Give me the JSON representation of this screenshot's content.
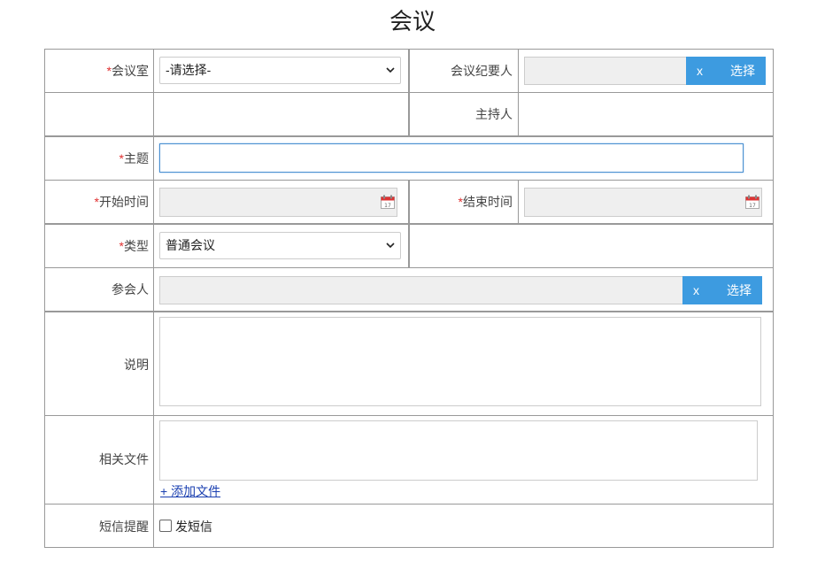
{
  "page": {
    "title": "会议"
  },
  "form": {
    "required_mark": "*",
    "room": {
      "label": "会议室",
      "value": "-请选择-"
    },
    "recorder": {
      "label": "会议纪要人",
      "value": "",
      "clear": "x",
      "choose": "选择"
    },
    "host": {
      "label": "主持人",
      "value": ""
    },
    "subject": {
      "label": "主题",
      "value": ""
    },
    "start_time": {
      "label": "开始时间",
      "value": ""
    },
    "end_time": {
      "label": "结束时间",
      "value": ""
    },
    "type": {
      "label": "类型",
      "value": "普通会议"
    },
    "attendees": {
      "label": "参会人",
      "value": "",
      "clear": "x",
      "choose": "选择"
    },
    "description": {
      "label": "说明",
      "value": ""
    },
    "files": {
      "label": "相关文件",
      "add_link": "+ 添加文件"
    },
    "sms": {
      "label": "短信提醒",
      "checkbox_label": "发短信",
      "checked": false
    }
  },
  "colors": {
    "accent": "#3d9be0",
    "required": "#e03030",
    "link": "#1a3fb0",
    "border": "#999999"
  },
  "icons": [
    "chevron-down-icon",
    "calendar-icon",
    "close-icon"
  ]
}
